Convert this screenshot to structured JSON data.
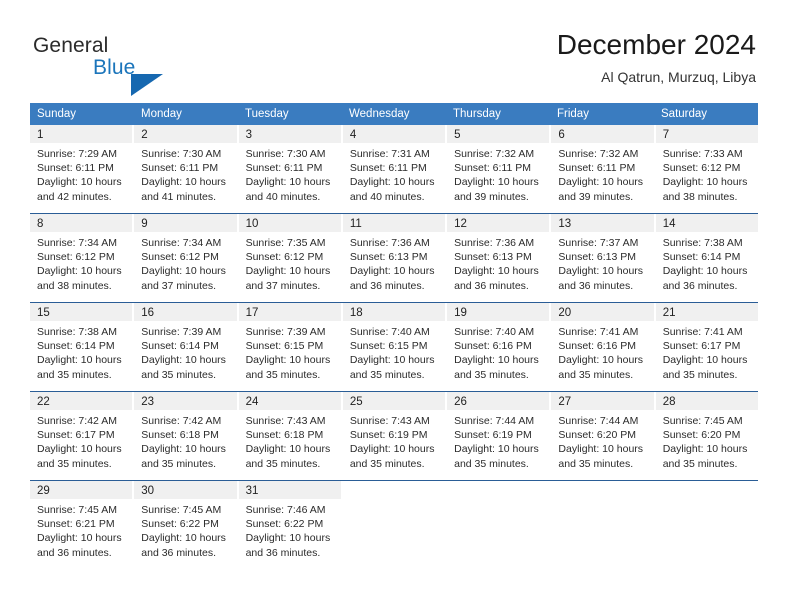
{
  "brand": {
    "name_part1": "General",
    "name_part2": "Blue",
    "accent_color": "#1b75bb",
    "triangle_icon": "triangle-icon"
  },
  "header": {
    "title": "December 2024",
    "subtitle": "Al Qatrun, Murzuq, Libya"
  },
  "weekdays": [
    "Sunday",
    "Monday",
    "Tuesday",
    "Wednesday",
    "Thursday",
    "Friday",
    "Saturday"
  ],
  "labels": {
    "sunrise_prefix": "Sunrise: ",
    "sunset_prefix": "Sunset: ",
    "daylight_prefix": "Daylight: "
  },
  "weeks": [
    [
      {
        "day": "1",
        "sunrise": "Sunrise: 7:29 AM",
        "sunset": "Sunset: 6:11 PM",
        "daylight": "Daylight: 10 hours and 42 minutes."
      },
      {
        "day": "2",
        "sunrise": "Sunrise: 7:30 AM",
        "sunset": "Sunset: 6:11 PM",
        "daylight": "Daylight: 10 hours and 41 minutes."
      },
      {
        "day": "3",
        "sunrise": "Sunrise: 7:30 AM",
        "sunset": "Sunset: 6:11 PM",
        "daylight": "Daylight: 10 hours and 40 minutes."
      },
      {
        "day": "4",
        "sunrise": "Sunrise: 7:31 AM",
        "sunset": "Sunset: 6:11 PM",
        "daylight": "Daylight: 10 hours and 40 minutes."
      },
      {
        "day": "5",
        "sunrise": "Sunrise: 7:32 AM",
        "sunset": "Sunset: 6:11 PM",
        "daylight": "Daylight: 10 hours and 39 minutes."
      },
      {
        "day": "6",
        "sunrise": "Sunrise: 7:32 AM",
        "sunset": "Sunset: 6:11 PM",
        "daylight": "Daylight: 10 hours and 39 minutes."
      },
      {
        "day": "7",
        "sunrise": "Sunrise: 7:33 AM",
        "sunset": "Sunset: 6:12 PM",
        "daylight": "Daylight: 10 hours and 38 minutes."
      }
    ],
    [
      {
        "day": "8",
        "sunrise": "Sunrise: 7:34 AM",
        "sunset": "Sunset: 6:12 PM",
        "daylight": "Daylight: 10 hours and 38 minutes."
      },
      {
        "day": "9",
        "sunrise": "Sunrise: 7:34 AM",
        "sunset": "Sunset: 6:12 PM",
        "daylight": "Daylight: 10 hours and 37 minutes."
      },
      {
        "day": "10",
        "sunrise": "Sunrise: 7:35 AM",
        "sunset": "Sunset: 6:12 PM",
        "daylight": "Daylight: 10 hours and 37 minutes."
      },
      {
        "day": "11",
        "sunrise": "Sunrise: 7:36 AM",
        "sunset": "Sunset: 6:13 PM",
        "daylight": "Daylight: 10 hours and 36 minutes."
      },
      {
        "day": "12",
        "sunrise": "Sunrise: 7:36 AM",
        "sunset": "Sunset: 6:13 PM",
        "daylight": "Daylight: 10 hours and 36 minutes."
      },
      {
        "day": "13",
        "sunrise": "Sunrise: 7:37 AM",
        "sunset": "Sunset: 6:13 PM",
        "daylight": "Daylight: 10 hours and 36 minutes."
      },
      {
        "day": "14",
        "sunrise": "Sunrise: 7:38 AM",
        "sunset": "Sunset: 6:14 PM",
        "daylight": "Daylight: 10 hours and 36 minutes."
      }
    ],
    [
      {
        "day": "15",
        "sunrise": "Sunrise: 7:38 AM",
        "sunset": "Sunset: 6:14 PM",
        "daylight": "Daylight: 10 hours and 35 minutes."
      },
      {
        "day": "16",
        "sunrise": "Sunrise: 7:39 AM",
        "sunset": "Sunset: 6:14 PM",
        "daylight": "Daylight: 10 hours and 35 minutes."
      },
      {
        "day": "17",
        "sunrise": "Sunrise: 7:39 AM",
        "sunset": "Sunset: 6:15 PM",
        "daylight": "Daylight: 10 hours and 35 minutes."
      },
      {
        "day": "18",
        "sunrise": "Sunrise: 7:40 AM",
        "sunset": "Sunset: 6:15 PM",
        "daylight": "Daylight: 10 hours and 35 minutes."
      },
      {
        "day": "19",
        "sunrise": "Sunrise: 7:40 AM",
        "sunset": "Sunset: 6:16 PM",
        "daylight": "Daylight: 10 hours and 35 minutes."
      },
      {
        "day": "20",
        "sunrise": "Sunrise: 7:41 AM",
        "sunset": "Sunset: 6:16 PM",
        "daylight": "Daylight: 10 hours and 35 minutes."
      },
      {
        "day": "21",
        "sunrise": "Sunrise: 7:41 AM",
        "sunset": "Sunset: 6:17 PM",
        "daylight": "Daylight: 10 hours and 35 minutes."
      }
    ],
    [
      {
        "day": "22",
        "sunrise": "Sunrise: 7:42 AM",
        "sunset": "Sunset: 6:17 PM",
        "daylight": "Daylight: 10 hours and 35 minutes."
      },
      {
        "day": "23",
        "sunrise": "Sunrise: 7:42 AM",
        "sunset": "Sunset: 6:18 PM",
        "daylight": "Daylight: 10 hours and 35 minutes."
      },
      {
        "day": "24",
        "sunrise": "Sunrise: 7:43 AM",
        "sunset": "Sunset: 6:18 PM",
        "daylight": "Daylight: 10 hours and 35 minutes."
      },
      {
        "day": "25",
        "sunrise": "Sunrise: 7:43 AM",
        "sunset": "Sunset: 6:19 PM",
        "daylight": "Daylight: 10 hours and 35 minutes."
      },
      {
        "day": "26",
        "sunrise": "Sunrise: 7:44 AM",
        "sunset": "Sunset: 6:19 PM",
        "daylight": "Daylight: 10 hours and 35 minutes."
      },
      {
        "day": "27",
        "sunrise": "Sunrise: 7:44 AM",
        "sunset": "Sunset: 6:20 PM",
        "daylight": "Daylight: 10 hours and 35 minutes."
      },
      {
        "day": "28",
        "sunrise": "Sunrise: 7:45 AM",
        "sunset": "Sunset: 6:20 PM",
        "daylight": "Daylight: 10 hours and 35 minutes."
      }
    ],
    [
      {
        "day": "29",
        "sunrise": "Sunrise: 7:45 AM",
        "sunset": "Sunset: 6:21 PM",
        "daylight": "Daylight: 10 hours and 36 minutes."
      },
      {
        "day": "30",
        "sunrise": "Sunrise: 7:45 AM",
        "sunset": "Sunset: 6:22 PM",
        "daylight": "Daylight: 10 hours and 36 minutes."
      },
      {
        "day": "31",
        "sunrise": "Sunrise: 7:46 AM",
        "sunset": "Sunset: 6:22 PM",
        "daylight": "Daylight: 10 hours and 36 minutes."
      },
      {
        "day": "",
        "sunrise": "",
        "sunset": "",
        "daylight": ""
      },
      {
        "day": "",
        "sunrise": "",
        "sunset": "",
        "daylight": ""
      },
      {
        "day": "",
        "sunrise": "",
        "sunset": "",
        "daylight": ""
      },
      {
        "day": "",
        "sunrise": "",
        "sunset": "",
        "daylight": ""
      }
    ]
  ]
}
